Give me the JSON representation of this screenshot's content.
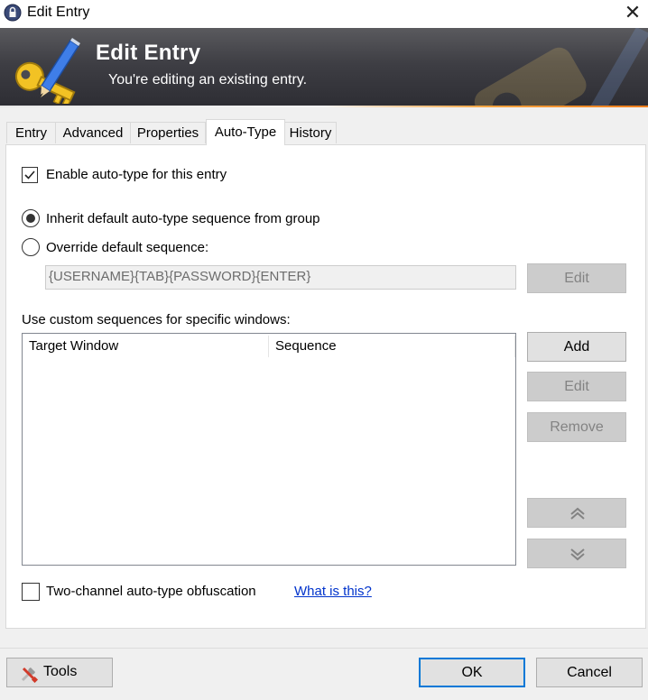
{
  "window": {
    "title": "Edit Entry",
    "close_glyph": "✕"
  },
  "banner": {
    "title": "Edit Entry",
    "subtitle": "You're editing an existing entry.",
    "icon": "key-pencil-icon"
  },
  "tabs": [
    {
      "label": "Entry",
      "active": false
    },
    {
      "label": "Advanced",
      "active": false
    },
    {
      "label": "Properties",
      "active": false
    },
    {
      "label": "Auto-Type",
      "active": true
    },
    {
      "label": "History",
      "active": false
    }
  ],
  "autotype": {
    "enable_label": "Enable auto-type for this entry",
    "enable_checked": true,
    "inherit_label": "Inherit default auto-type sequence from group",
    "inherit_selected": true,
    "override_label": "Override default sequence:",
    "override_selected": false,
    "sequence_value": "{USERNAME}{TAB}{PASSWORD}{ENTER}",
    "edit_label": "Edit",
    "custom_label": "Use custom sequences for specific windows:",
    "columns": [
      "Target Window",
      "Sequence"
    ],
    "rows": [],
    "add_label": "Add",
    "edit2_label": "Edit",
    "remove_label": "Remove",
    "move_up_glyph": "︽",
    "move_down_glyph": "︾",
    "obfuscation_label": "Two-channel auto-type obfuscation",
    "obfuscation_checked": false,
    "help_link": "What is this?"
  },
  "footer": {
    "tools_label": "Tools",
    "ok_label": "OK",
    "cancel_label": "Cancel"
  },
  "colors": {
    "banner_dark": "#2d2d33",
    "accent_orange": "#ee7d1c",
    "link": "#0033cc",
    "ok_border": "#0078d7"
  }
}
